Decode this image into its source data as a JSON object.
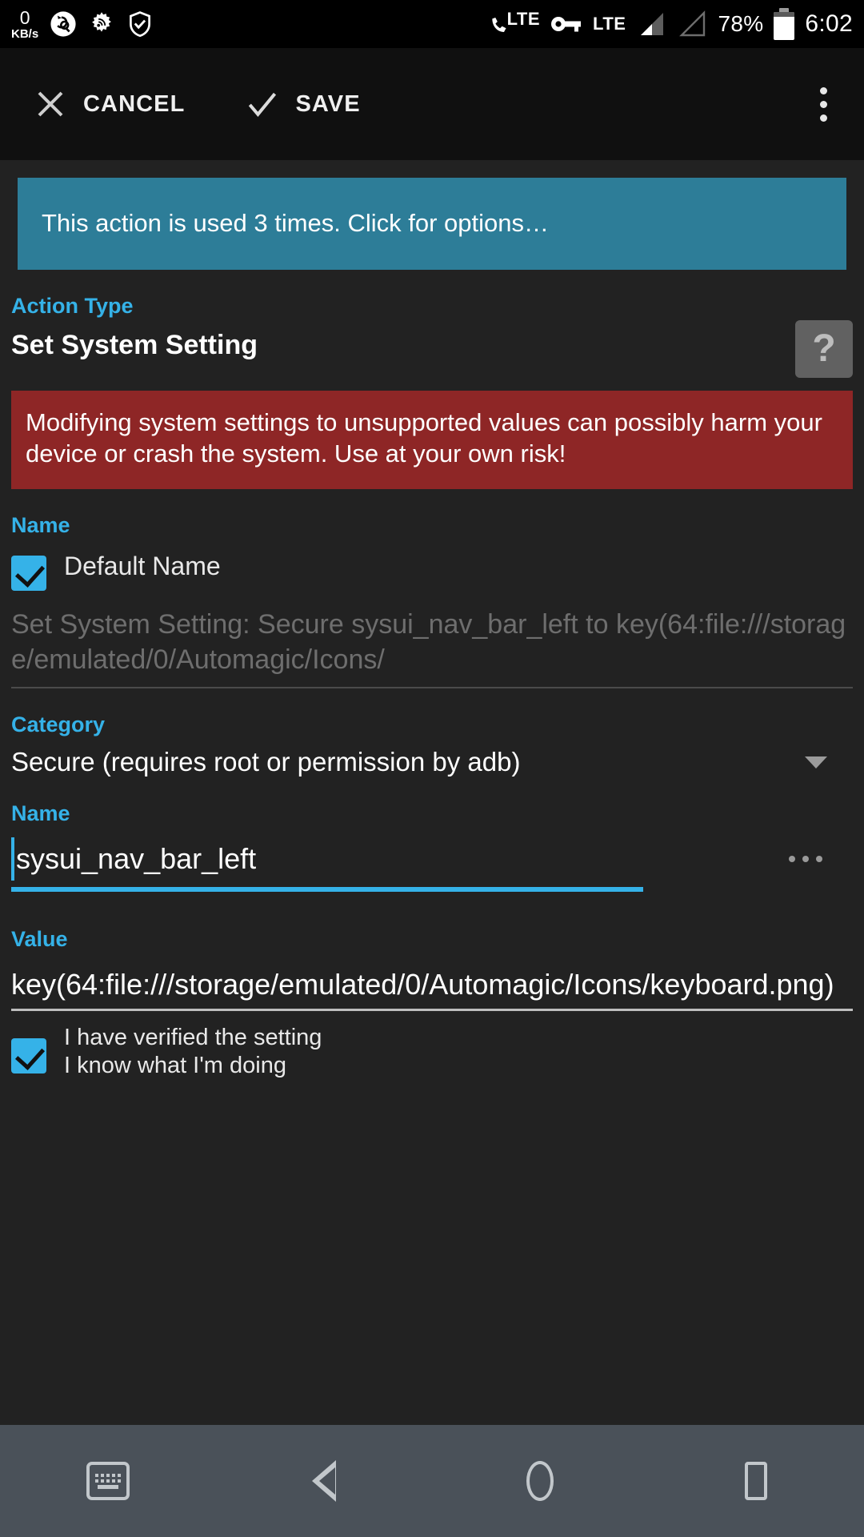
{
  "statusbar": {
    "netspeed_value": "0",
    "netspeed_unit": "KB/s",
    "icons": [
      "network-speed-icon",
      "search-refresh-icon",
      "gear-rss-icon",
      "shield-check-icon"
    ],
    "call_lte_label": "LTE",
    "vpn_key_icon": "vpn-key-icon",
    "data_lte_label": "LTE",
    "signal_icon_1": "signal-bars-icon",
    "signal_icon_2": "signal-bars-empty-icon",
    "battery_percent": "78%",
    "battery_icon": "battery-icon",
    "clock": "6:02"
  },
  "appbar": {
    "cancel_label": "CANCEL",
    "cancel_icon": "close-icon",
    "save_label": "SAVE",
    "save_icon": "check-icon",
    "overflow_icon": "overflow-menu-icon"
  },
  "banner": {
    "text": "This action is used 3 times. Click for options…",
    "color": "#2d7d98"
  },
  "action_type": {
    "label": "Action Type",
    "value": "Set System Setting",
    "help_icon": "help-question-icon",
    "help_glyph": "?"
  },
  "warning": {
    "text": "Modifying system settings to unsupported values can possibly harm your device or crash the system. Use at your own risk!",
    "color": "#8e2626"
  },
  "name_section": {
    "label": "Name",
    "default_name_checkbox_label": "Default Name",
    "default_name_checked": true,
    "generated_name": "Set System Setting: Secure sysui_nav_bar_left to key(64:file:///storage/emulated/0/Automagic/Icons/"
  },
  "category_section": {
    "label": "Category",
    "selected_value": "Secure (requires root or permission by adb)",
    "dropdown_icon": "chevron-down-icon"
  },
  "setting_name_section": {
    "label": "Name",
    "value": "sysui_nav_bar_left",
    "more_icon": "more-options-icon"
  },
  "value_section": {
    "label": "Value",
    "value": "key(64:file:///storage/emulated/0/Automagic/Icons/keyboard.png)"
  },
  "verify_section": {
    "line1": "I have verified the setting",
    "line2": "I know what I'm doing",
    "checked": true
  },
  "navbar": {
    "keyboard_icon": "keyboard-icon",
    "back_icon": "back-triangle-icon",
    "home_icon": "home-circle-icon",
    "recents_icon": "recents-square-icon"
  },
  "theme": {
    "accent": "#35b2e8",
    "background": "#222222",
    "appbar": "#101010",
    "navbar": "#4a5159"
  }
}
